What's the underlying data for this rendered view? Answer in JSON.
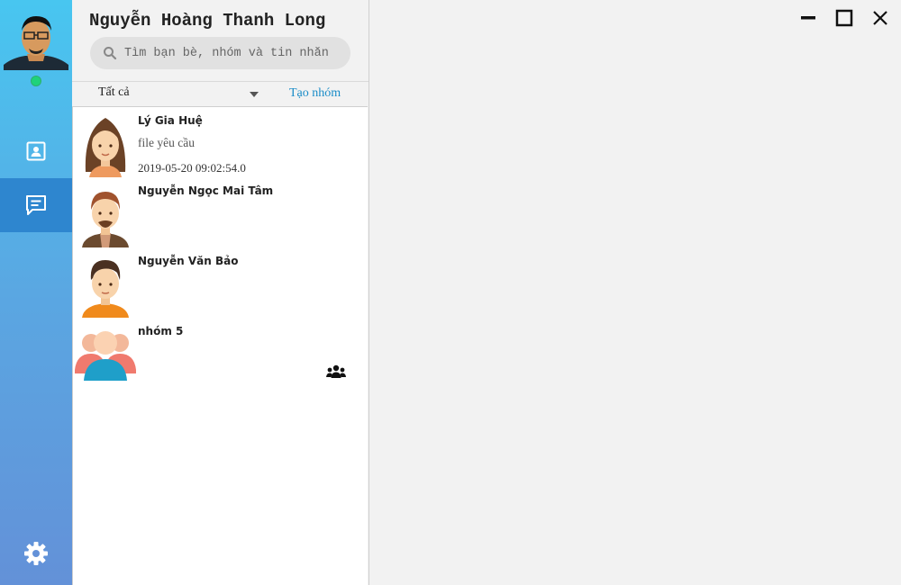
{
  "user": {
    "name": "Nguyễn Hoàng Thanh Long",
    "status_color": "#1fd27a"
  },
  "nav": {
    "items": [
      {
        "icon": "contact-card-icon",
        "active": false
      },
      {
        "icon": "chat-icon",
        "active": true
      }
    ],
    "settings_icon": "gear-icon",
    "active_color": "#2e86cf"
  },
  "search": {
    "placeholder": "Tìm bạn bè, nhóm và tin nhắn",
    "value": ""
  },
  "filter": {
    "selected": "Tất cả",
    "create_group_label": "Tạo nhóm"
  },
  "conversations": [
    {
      "name": "Lý Gia Huệ",
      "preview": "file yêu cầu",
      "time": "2019-05-20 09:02:54.0",
      "is_group": false
    },
    {
      "name": "Nguyễn Ngọc Mai Tâm",
      "preview": "",
      "time": "",
      "is_group": false
    },
    {
      "name": "Nguyễn Văn Bảo",
      "preview": "",
      "time": "",
      "is_group": false
    },
    {
      "name": "nhóm 5",
      "preview": "",
      "time": "",
      "is_group": true
    }
  ],
  "window": {
    "controls": [
      "minimize-icon",
      "maximize-icon",
      "close-icon"
    ]
  }
}
